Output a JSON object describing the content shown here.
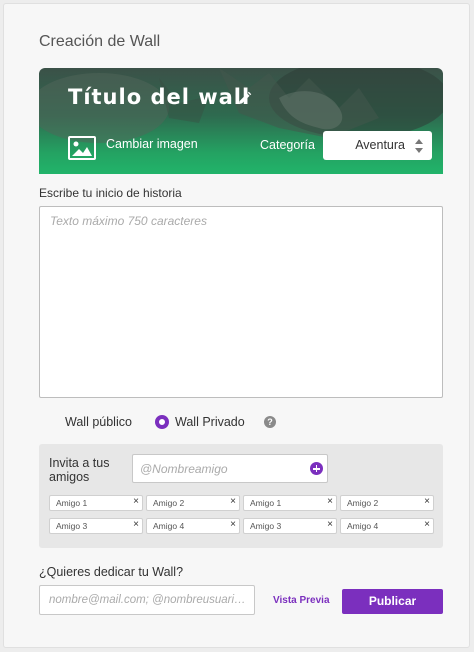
{
  "page": {
    "title": "Creación de Wall"
  },
  "hero": {
    "wall_title": "Título del wall",
    "change_image_label": "Cambiar imagen",
    "category_label": "Categoría",
    "category_value": "Aventura"
  },
  "story": {
    "label": "Escribe tu inicio de historia",
    "placeholder": "Texto máximo 750 caracteres"
  },
  "privacy": {
    "public_label": "Wall público",
    "private_label": "Wall Privado",
    "selected": "private",
    "help_glyph": "?"
  },
  "invite": {
    "label": "Invita a tus amigos",
    "placeholder": "@Nombreamigo",
    "remove_glyph": "×",
    "friends": [
      "Amigo 1",
      "Amigo 2",
      "Amigo 1",
      "Amigo 2",
      "Amigo 3",
      "Amigo 4",
      "Amigo 3",
      "Amigo 4"
    ]
  },
  "dedicate": {
    "label": "¿Quieres dedicar tu Wall?",
    "placeholder": "nombre@mail.com; @nombreusuario; ..."
  },
  "actions": {
    "preview_label": "Vista Previa",
    "publish_label": "Publicar"
  },
  "colors": {
    "accent": "#7b2fbe",
    "hero_green": "#21b46a"
  },
  "icons": {
    "edit": "pencil-icon",
    "image": "image-icon",
    "select": "select-arrows-icon",
    "help": "help-icon",
    "add": "plus-circle-icon",
    "remove": "close-icon"
  }
}
